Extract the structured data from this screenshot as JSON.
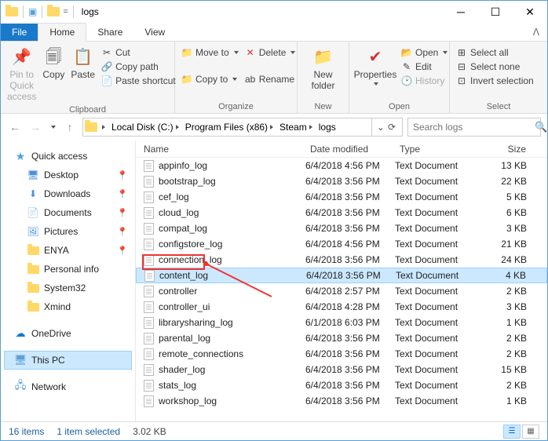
{
  "window": {
    "title": "logs"
  },
  "tabs": {
    "file": "File",
    "home": "Home",
    "share": "Share",
    "view": "View"
  },
  "ribbon": {
    "clipboard": {
      "label": "Clipboard",
      "pin": "Pin to Quick\naccess",
      "copy": "Copy",
      "paste": "Paste",
      "cut": "Cut",
      "copy_path": "Copy path",
      "paste_shortcut": "Paste shortcut"
    },
    "organize": {
      "label": "Organize",
      "move_to": "Move to",
      "copy_to": "Copy to",
      "delete": "Delete",
      "rename": "Rename"
    },
    "new": {
      "label": "New",
      "new_folder": "New\nfolder"
    },
    "open": {
      "label": "Open",
      "properties": "Properties",
      "open": "Open",
      "edit": "Edit",
      "history": "History"
    },
    "select": {
      "label": "Select",
      "select_all": "Select all",
      "select_none": "Select none",
      "invert": "Invert selection"
    }
  },
  "breadcrumb": [
    "Local Disk (C:)",
    "Program Files (x86)",
    "Steam",
    "logs"
  ],
  "search": {
    "placeholder": "Search logs"
  },
  "tree": {
    "quick_access": "Quick access",
    "items": [
      {
        "label": "Desktop",
        "pinned": true
      },
      {
        "label": "Downloads",
        "pinned": true
      },
      {
        "label": "Documents",
        "pinned": true
      },
      {
        "label": "Pictures",
        "pinned": true
      },
      {
        "label": "ENYA",
        "pinned": true
      },
      {
        "label": "Personal info",
        "pinned": false
      },
      {
        "label": "System32",
        "pinned": false
      },
      {
        "label": "Xmind",
        "pinned": false
      }
    ],
    "onedrive": "OneDrive",
    "this_pc": "This PC",
    "network": "Network"
  },
  "columns": {
    "name": "Name",
    "date": "Date modified",
    "type": "Type",
    "size": "Size"
  },
  "files": [
    {
      "name": "appinfo_log",
      "date": "6/4/2018 4:56 PM",
      "type": "Text Document",
      "size": "13 KB"
    },
    {
      "name": "bootstrap_log",
      "date": "6/4/2018 3:56 PM",
      "type": "Text Document",
      "size": "22 KB"
    },
    {
      "name": "cef_log",
      "date": "6/4/2018 3:56 PM",
      "type": "Text Document",
      "size": "5 KB"
    },
    {
      "name": "cloud_log",
      "date": "6/4/2018 3:56 PM",
      "type": "Text Document",
      "size": "6 KB"
    },
    {
      "name": "compat_log",
      "date": "6/4/2018 3:56 PM",
      "type": "Text Document",
      "size": "3 KB"
    },
    {
      "name": "configstore_log",
      "date": "6/4/2018 4:56 PM",
      "type": "Text Document",
      "size": "21 KB"
    },
    {
      "name": "connection_log",
      "date": "6/4/2018 3:56 PM",
      "type": "Text Document",
      "size": "24 KB"
    },
    {
      "name": "content_log",
      "date": "6/4/2018 3:56 PM",
      "type": "Text Document",
      "size": "4 KB",
      "selected": true
    },
    {
      "name": "controller",
      "date": "6/4/2018 2:57 PM",
      "type": "Text Document",
      "size": "2 KB"
    },
    {
      "name": "controller_ui",
      "date": "6/4/2018 4:28 PM",
      "type": "Text Document",
      "size": "3 KB"
    },
    {
      "name": "librarysharing_log",
      "date": "6/1/2018 6:03 PM",
      "type": "Text Document",
      "size": "1 KB"
    },
    {
      "name": "parental_log",
      "date": "6/4/2018 3:56 PM",
      "type": "Text Document",
      "size": "2 KB"
    },
    {
      "name": "remote_connections",
      "date": "6/4/2018 3:56 PM",
      "type": "Text Document",
      "size": "2 KB"
    },
    {
      "name": "shader_log",
      "date": "6/4/2018 3:56 PM",
      "type": "Text Document",
      "size": "15 KB"
    },
    {
      "name": "stats_log",
      "date": "6/4/2018 3:56 PM",
      "type": "Text Document",
      "size": "2 KB"
    },
    {
      "name": "workshop_log",
      "date": "6/4/2018 3:56 PM",
      "type": "Text Document",
      "size": "1 KB"
    }
  ],
  "status": {
    "count": "16 items",
    "selection": "1 item selected",
    "size": "3.02 KB"
  }
}
